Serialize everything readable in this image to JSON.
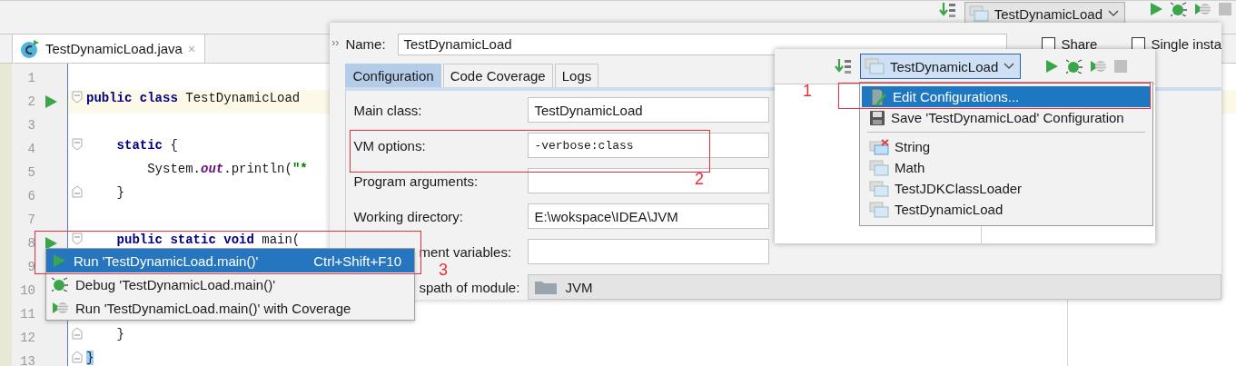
{
  "toolbar": {
    "run_config": "TestDynamicLoad"
  },
  "editor": {
    "tab": {
      "label": "TestDynamicLoad.java",
      "close_glyph": "×",
      "selected": true
    },
    "lines": [
      {
        "number": "1"
      },
      {
        "number": "2",
        "run": true,
        "fold_start": true,
        "current": true,
        "tokens": [
          {
            "text": "public class",
            "kind": "keyword"
          },
          {
            "text": " TestDynamicLoad",
            "kind": "plain"
          }
        ]
      },
      {
        "number": "3"
      },
      {
        "number": "4",
        "fold_start": true,
        "tokens": [
          {
            "text": "    static",
            "kind": "keyword"
          },
          {
            "text": " {",
            "kind": "plain"
          }
        ]
      },
      {
        "number": "5",
        "tokens": [
          {
            "text": "        System.",
            "kind": "plain"
          },
          {
            "text": "out",
            "kind": "field"
          },
          {
            "text": ".println(",
            "kind": "plain"
          },
          {
            "text": "\"*",
            "kind": "string"
          }
        ]
      },
      {
        "number": "6",
        "fold_end": true,
        "tokens": [
          {
            "text": "    }",
            "kind": "plain"
          }
        ]
      },
      {
        "number": "7"
      },
      {
        "number": "8",
        "run": true,
        "fold_start": true,
        "tokens": [
          {
            "text": "    public static void",
            "kind": "keyword"
          },
          {
            "text": " main(",
            "kind": "plain"
          }
        ]
      },
      {
        "number": "9"
      },
      {
        "number": "10"
      },
      {
        "number": "11"
      },
      {
        "number": "12",
        "fold_end": true,
        "tokens": [
          {
            "text": "    }",
            "kind": "plain"
          }
        ]
      },
      {
        "number": "13",
        "fold_end": true,
        "tokens": [
          {
            "text": "}",
            "kind": "match"
          }
        ]
      }
    ]
  },
  "context_menu": {
    "items": [
      {
        "label": "Run 'TestDynamicLoad.main()'",
        "shortcut": "Ctrl+Shift+F10",
        "kind": "run",
        "selected": true
      },
      {
        "label": "Debug 'TestDynamicLoad.main()'",
        "kind": "debug",
        "selected": false
      },
      {
        "label": "Run 'TestDynamicLoad.main()' with Coverage",
        "kind": "coverage",
        "selected": false
      }
    ]
  },
  "dialog": {
    "sidebar_toggle": "››",
    "name_label": "Name:",
    "name_value": "TestDynamicLoad",
    "options": [
      {
        "label": "Share",
        "checked": false
      },
      {
        "label": "Single insta",
        "checked": false
      }
    ],
    "tabs": [
      {
        "label": "Configuration",
        "selected": true
      },
      {
        "label": "Code Coverage",
        "selected": false
      },
      {
        "label": "Logs",
        "selected": false
      }
    ],
    "fields": [
      {
        "label": "Main class:",
        "value": "TestDynamicLoad",
        "kind": "text"
      },
      {
        "label": "VM options:",
        "value": "-verbose:class",
        "kind": "mono"
      },
      {
        "label": "Program arguments:",
        "kind": "text"
      },
      {
        "label": "Working directory:",
        "value": "E:\\wokspace\\IDEA\\JVM",
        "kind": "text"
      },
      {
        "label": "ment variables:",
        "kind": "text",
        "covered": true
      },
      {
        "label": "spath of module:",
        "value": "JVM",
        "kind": "module",
        "covered": true
      }
    ]
  },
  "run_popup": {
    "combo": "TestDynamicLoad",
    "actions": [
      {
        "label": "Edit Configurations...",
        "kind": "edit",
        "selected": true
      },
      {
        "label": "Save 'TestDynamicLoad' Configuration",
        "kind": "save",
        "selected": false
      }
    ],
    "configurations": [
      {
        "label": "String",
        "error": true,
        "selected": false
      },
      {
        "label": "Math",
        "error": false,
        "selected": false
      },
      {
        "label": "TestJDKClassLoader",
        "error": false,
        "selected": false
      },
      {
        "label": "TestDynamicLoad",
        "error": false,
        "selected": false
      }
    ]
  },
  "annotations": [
    {
      "label": "1"
    },
    {
      "label": "2"
    },
    {
      "label": "3"
    }
  ]
}
